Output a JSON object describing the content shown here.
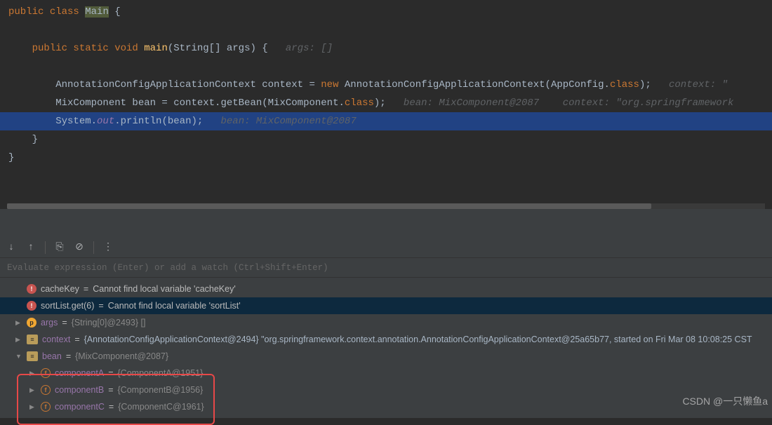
{
  "code": {
    "lines": [
      {
        "tokens": [
          {
            "t": "public ",
            "c": "kw"
          },
          {
            "t": "class ",
            "c": "kw"
          },
          {
            "t": "Main",
            "c": "highlight-word"
          },
          {
            "t": " {",
            "c": ""
          }
        ]
      },
      {
        "tokens": []
      },
      {
        "tokens": [
          {
            "t": "    ",
            "c": ""
          },
          {
            "t": "public static void ",
            "c": "kw"
          },
          {
            "t": "main",
            "c": "method"
          },
          {
            "t": "(String[] args) {   ",
            "c": ""
          },
          {
            "t": "args: []",
            "c": "hint"
          }
        ]
      },
      {
        "tokens": []
      },
      {
        "tokens": [
          {
            "t": "        AnnotationConfigApplicationContext context = ",
            "c": ""
          },
          {
            "t": "new ",
            "c": "kw"
          },
          {
            "t": "AnnotationConfigApplicationContext(AppConfig.",
            "c": ""
          },
          {
            "t": "class",
            "c": "kw"
          },
          {
            "t": ");   ",
            "c": ""
          },
          {
            "t": "context: \"",
            "c": "hint"
          }
        ]
      },
      {
        "tokens": [
          {
            "t": "        MixComponent bean = context.getBean(MixComponent.",
            "c": ""
          },
          {
            "t": "class",
            "c": "kw"
          },
          {
            "t": ");   ",
            "c": ""
          },
          {
            "t": "bean: MixComponent@2087    context: \"org.springframework",
            "c": "hint"
          }
        ]
      },
      {
        "highlighted": true,
        "tokens": [
          {
            "t": "        System.",
            "c": ""
          },
          {
            "t": "out",
            "c": "static-field"
          },
          {
            "t": ".println(bean);   ",
            "c": ""
          },
          {
            "t": "bean: MixComponent@2087",
            "c": "hint"
          }
        ]
      },
      {
        "tokens": [
          {
            "t": "    }",
            "c": ""
          }
        ]
      },
      {
        "tokens": [
          {
            "t": "}",
            "c": ""
          }
        ]
      }
    ]
  },
  "watch_placeholder": "Evaluate expression (Enter) or add a watch (Ctrl+Shift+Enter)",
  "variables": [
    {
      "expand": "",
      "icon": "error",
      "iconText": "!",
      "name": "cacheKey",
      "nameCls": "error-name",
      "eq": " = ",
      "val": "Cannot find local variable 'cacheKey'",
      "valCls": "error",
      "indent": 0
    },
    {
      "expand": "",
      "icon": "error",
      "iconText": "!",
      "name": "sortList.get(6)",
      "nameCls": "error-name",
      "eq": " = ",
      "val": "Cannot find local variable 'sortList'",
      "valCls": "",
      "indent": 0,
      "selected": true
    },
    {
      "expand": "▶",
      "icon": "param-p",
      "iconText": "p",
      "name": "args",
      "nameCls": "var-name",
      "eq": " = ",
      "val": "{String[0]@2493} []",
      "valCls": "var-val",
      "indent": 0
    },
    {
      "expand": "▶",
      "icon": "object",
      "iconText": "≡",
      "name": "context",
      "nameCls": "var-name",
      "eq": " = ",
      "val": "{AnnotationConfigApplicationContext@2494} \"org.springframework.context.annotation.AnnotationConfigApplicationContext@25a65b77, started on Fri Mar 08 10:08:25 CST",
      "valCls": "str",
      "indent": 0
    },
    {
      "expand": "▼",
      "icon": "object",
      "iconText": "≡",
      "name": "bean",
      "nameCls": "var-name",
      "eq": " = ",
      "val": "{MixComponent@2087}",
      "valCls": "var-val",
      "indent": 0
    },
    {
      "expand": "▶",
      "icon": "field",
      "iconText": "f",
      "name": "componentA",
      "nameCls": "var-name",
      "eq": " = ",
      "val": "{ComponentA@1951}",
      "valCls": "var-val",
      "indent": 1
    },
    {
      "expand": "▶",
      "icon": "field",
      "iconText": "f",
      "name": "componentB",
      "nameCls": "var-name",
      "eq": " = ",
      "val": "{ComponentB@1956}",
      "valCls": "var-val",
      "indent": 1
    },
    {
      "expand": "▶",
      "icon": "field",
      "iconText": "f",
      "name": "componentC",
      "nameCls": "var-name",
      "eq": " = ",
      "val": "{ComponentC@1961}",
      "valCls": "var-val",
      "indent": 1
    }
  ],
  "toolbar_icons": {
    "down": "↓",
    "up": "↑",
    "copy": "⎘",
    "clear": "⊘",
    "more": "⋮"
  },
  "watermark": "CSDN @一只懒鱼a"
}
